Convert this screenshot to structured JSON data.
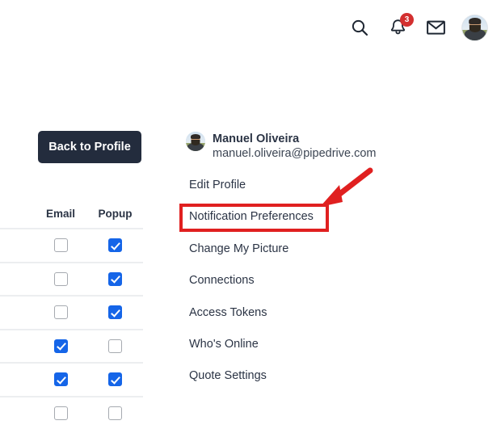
{
  "topbar": {
    "icons": [
      {
        "name": "search-icon",
        "label": "Search"
      },
      {
        "name": "bell-icon",
        "label": "Notifications",
        "badge": "3"
      },
      {
        "name": "envelope-icon",
        "label": "Messages"
      },
      {
        "name": "user-avatar",
        "label": "Manuel Oliveira"
      }
    ],
    "notification_count": "3"
  },
  "buttons": {
    "back_to_profile": "Back to Profile"
  },
  "table": {
    "headers": [
      "",
      "Email",
      "Popup"
    ],
    "rows": [
      {
        "email": false,
        "popup": true
      },
      {
        "email": false,
        "popup": true
      },
      {
        "email": false,
        "popup": true
      },
      {
        "email": true,
        "popup": false
      },
      {
        "email": true,
        "popup": true
      },
      {
        "email": false,
        "popup": false
      }
    ]
  },
  "profile": {
    "name": "Manuel Oliveira",
    "email": "manuel.oliveira@pipedrive.com"
  },
  "menu": {
    "items": [
      {
        "label": "Edit Profile"
      },
      {
        "label": "Notification Preferences"
      },
      {
        "label": "Change My Picture"
      },
      {
        "label": "Connections"
      },
      {
        "label": "Access Tokens"
      },
      {
        "label": "Who's Online"
      },
      {
        "label": "Quote Settings"
      }
    ],
    "highlighted_index": 1
  },
  "colors": {
    "accent_blue": "#1565e8",
    "button_dark": "#232c3d",
    "annotation_red": "#e02020",
    "badge_red": "#d32f2f"
  }
}
